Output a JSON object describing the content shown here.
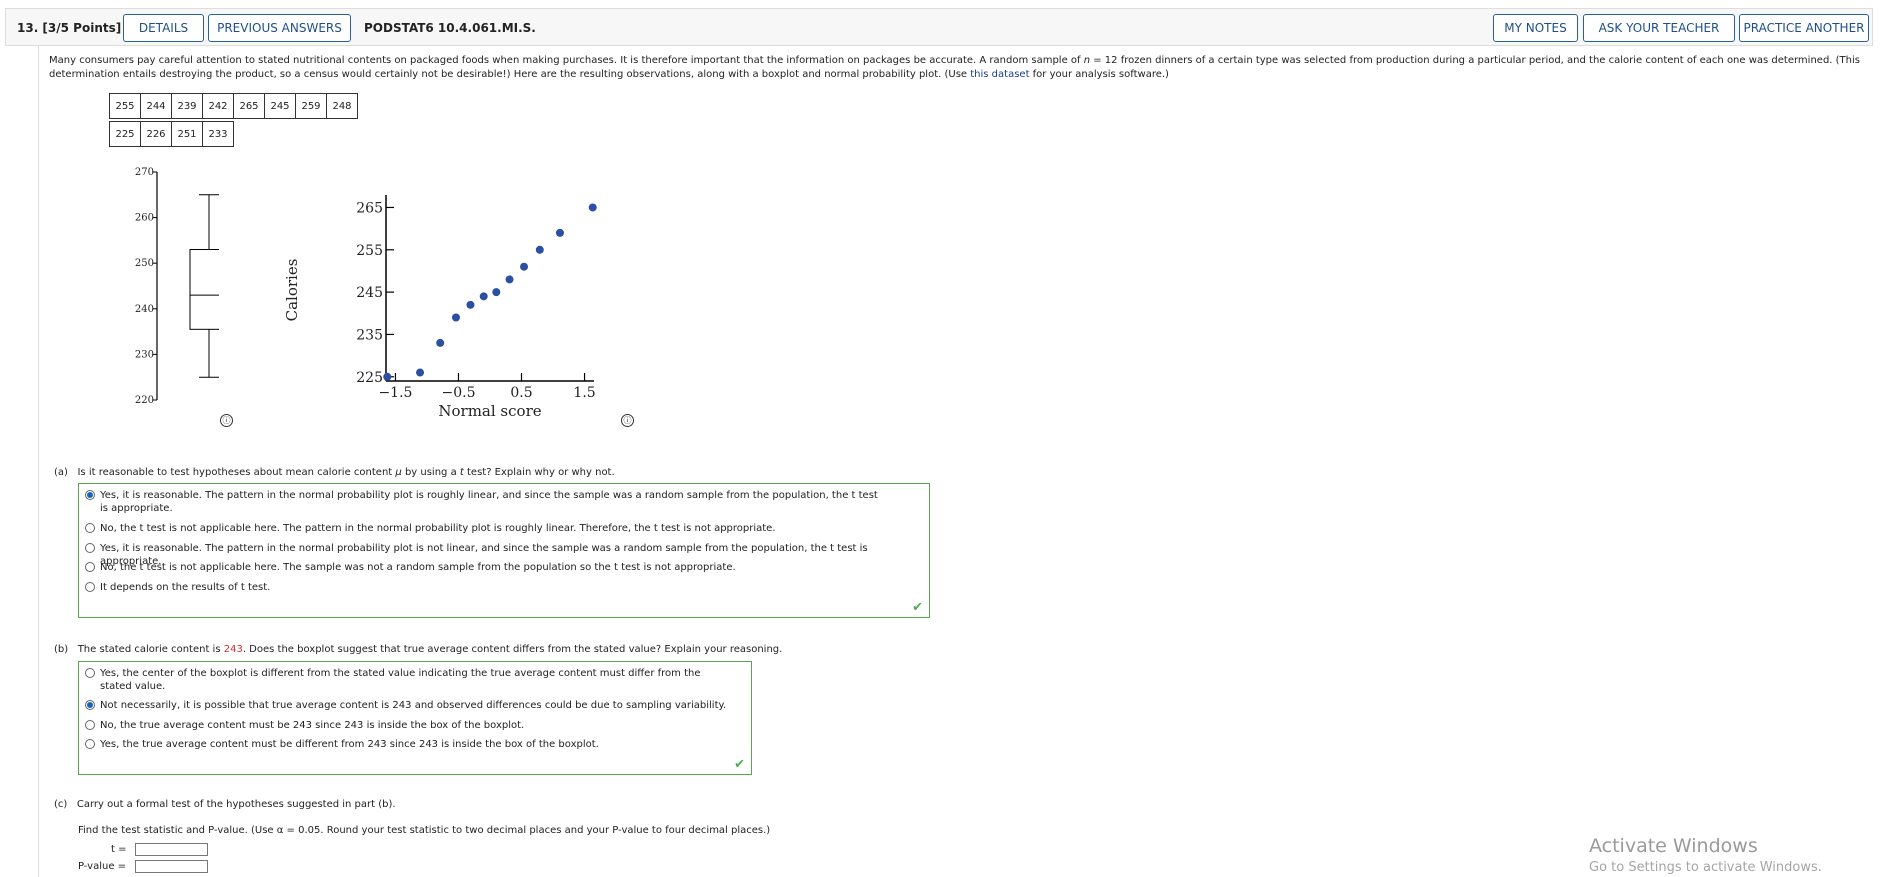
{
  "header": {
    "question_number": "13. [3/5 Points]",
    "details_label": "DETAILS",
    "previous_answers_label": "PREVIOUS ANSWERS",
    "problem_code": "PODSTAT6 10.4.061.MI.S.",
    "my_notes_label": "MY NOTES",
    "ask_teacher_label": "ASK YOUR TEACHER",
    "practice_another_label": "PRACTICE ANOTHER"
  },
  "intro": {
    "text_1": "Many consumers pay careful attention to stated nutritional contents on packaged foods when making purchases. It is therefore important that the information on packages be accurate. A random sample of ",
    "n_label": "n",
    "text_2": " = 12 frozen dinners of a certain type was selected from production during a particular period, and the calorie content of each one was determined. (This determination entails destroying the product, so a census would certainly not be desirable!) Here are the resulting observations, along with a boxplot and normal probability plot. (Use ",
    "link_text": "this dataset",
    "text_3": " for your analysis software.)"
  },
  "data_table": {
    "row1": [
      "255",
      "244",
      "239",
      "242",
      "265",
      "245",
      "259",
      "248"
    ],
    "row2": [
      "225",
      "226",
      "251",
      "233"
    ]
  },
  "chart_data": [
    {
      "type": "boxplot",
      "ylim": [
        220,
        270
      ],
      "yticks": [
        "220",
        "230",
        "240",
        "250",
        "260",
        "270"
      ],
      "min": 225,
      "q1": 235.5,
      "median": 243,
      "q3": 253,
      "max": 265
    },
    {
      "type": "scatter",
      "xlabel": "Normal score",
      "ylabel": "Calories",
      "xticks": [
        "−1.5",
        "−0.5",
        "0.5",
        "1.5"
      ],
      "yticks": [
        "225",
        "235",
        "245",
        "255",
        "265"
      ],
      "xlim": [
        -1.65,
        1.65
      ],
      "ylim": [
        224,
        267
      ],
      "points": [
        {
          "x": -1.63,
          "y": 225
        },
        {
          "x": -1.11,
          "y": 226
        },
        {
          "x": -0.79,
          "y": 233
        },
        {
          "x": -0.54,
          "y": 239
        },
        {
          "x": -0.31,
          "y": 242
        },
        {
          "x": -0.1,
          "y": 244
        },
        {
          "x": 0.1,
          "y": 245
        },
        {
          "x": 0.31,
          "y": 248
        },
        {
          "x": 0.54,
          "y": 251
        },
        {
          "x": 0.79,
          "y": 255
        },
        {
          "x": 1.11,
          "y": 259
        },
        {
          "x": 1.63,
          "y": 265
        }
      ]
    }
  ],
  "info_icon": "ⓘ",
  "part_a": {
    "label": "(a)",
    "question_1": "Is it reasonable to test hypotheses about mean calorie content ",
    "mu": "μ",
    "question_2": " by using a ",
    "t": "t",
    "question_3": " test? Explain why or why not.",
    "options": [
      "Yes, it is reasonable. The pattern in the normal probability plot is roughly linear, and since the sample was a random sample from the population, the t test is appropriate.",
      "No, the t test is not applicable here. The pattern in the normal probability plot is roughly linear. Therefore, the t test is not appropriate.",
      "Yes, it is reasonable. The pattern in the normal probability plot is not linear, and since the sample was a random sample from the population, the t test is appropriate.",
      "No, the t test is not applicable here. The sample was not a random sample from the population so the t test is not appropriate.",
      "It depends on the results of t test."
    ],
    "selected": 0
  },
  "part_b": {
    "label": "(b)",
    "question_1": "The stated calorie content is ",
    "stated_value": "243",
    "question_2": ". Does the boxplot suggest that true average content differs from the stated value? Explain your reasoning.",
    "options": [
      "Yes, the center of the boxplot is different from the stated value indicating the true average content must differ from the stated value.",
      "Not necessarily, it is possible that true average content is 243 and observed differences could be due to sampling variability.",
      "No, the true average content must be 243 since 243 is inside the box of the boxplot.",
      "Yes, the true average content must be different from 243 since 243 is inside the box of the boxplot."
    ],
    "selected": 1
  },
  "part_c": {
    "label": "(c)",
    "question": "Carry out a formal test of the hypotheses suggested in part (b).",
    "instruction": "Find the test statistic and P-value. (Use α = 0.05. Round your test statistic to two decimal places and your P-value to four decimal places.)",
    "t_label": "t =",
    "p_label": "P-value =",
    "t_value": "",
    "p_value": ""
  },
  "check_mark": "✔",
  "watermark": {
    "line1": "Activate Windows",
    "line2": "Go to Settings to activate Windows."
  }
}
